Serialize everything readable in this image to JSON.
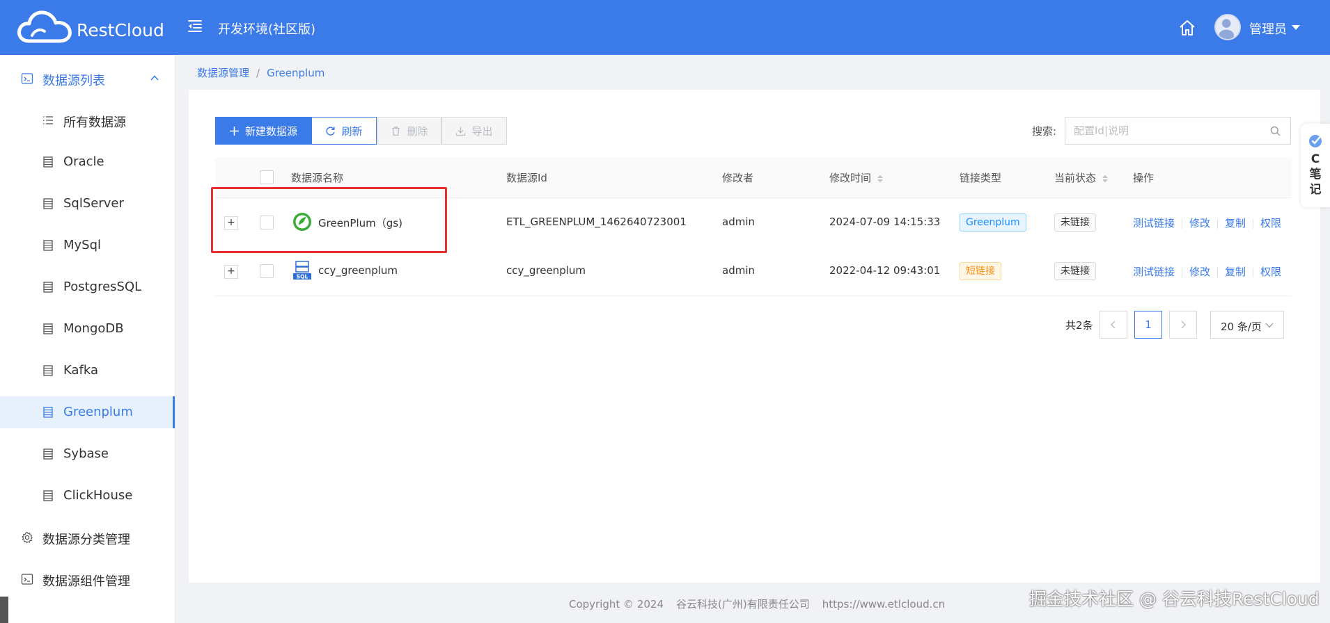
{
  "header": {
    "app_name": "RestCloud",
    "env_title": "开发环境(社区版)",
    "user_name": "管理员"
  },
  "sidebar": {
    "items": [
      {
        "label": "数据源列表",
        "type": "parent",
        "icon": "terminal-icon",
        "open": true
      },
      {
        "label": "所有数据源",
        "type": "child",
        "icon": "list-icon"
      },
      {
        "label": "Oracle",
        "type": "child",
        "icon": "database-icon"
      },
      {
        "label": "SqlServer",
        "type": "child",
        "icon": "database-icon"
      },
      {
        "label": "MySql",
        "type": "child",
        "icon": "database-icon"
      },
      {
        "label": "PostgresSQL",
        "type": "child",
        "icon": "database-icon"
      },
      {
        "label": "MongoDB",
        "type": "child",
        "icon": "database-icon"
      },
      {
        "label": "Kafka",
        "type": "child",
        "icon": "database-icon"
      },
      {
        "label": "Greenplum",
        "type": "child",
        "icon": "database-icon",
        "active": true
      },
      {
        "label": "Sybase",
        "type": "child",
        "icon": "database-icon"
      },
      {
        "label": "ClickHouse",
        "type": "child",
        "icon": "database-icon"
      },
      {
        "label": "数据源分类管理",
        "type": "parent",
        "icon": "gear-icon"
      },
      {
        "label": "数据源组件管理",
        "type": "parent",
        "icon": "terminal-icon"
      }
    ]
  },
  "breadcrumb": {
    "root": "数据源管理",
    "separator": "/",
    "current": "Greenplum"
  },
  "toolbar": {
    "new_label": "新建数据源",
    "refresh_label": "刷新",
    "delete_label": "删除",
    "export_label": "导出",
    "search_label": "搜索:",
    "search_placeholder": "配置Id|说明",
    "search_value": ""
  },
  "table": {
    "headers": {
      "name": "数据源名称",
      "id": "数据源Id",
      "modifier": "修改者",
      "time": "修改时间",
      "link_type": "链接类型",
      "status": "当前状态",
      "actions": "操作"
    },
    "rows": [
      {
        "name": "GreenPlum（gs)",
        "icon": "greenplum-logo-icon",
        "id": "ETL_GREENPLUM_1462640723001",
        "modifier": "admin",
        "time": "2024-07-09 14:15:33",
        "link_type": "Greenplum",
        "link_color": "blue",
        "status": "未链接"
      },
      {
        "name": "ccy_greenplum",
        "icon": "sql-server-icon",
        "id": "ccy_greenplum",
        "modifier": "admin",
        "time": "2022-04-12 09:43:01",
        "link_type": "短链接",
        "link_color": "orange",
        "status": "未链接"
      }
    ],
    "row_actions": [
      "测试链接",
      "修改",
      "复制",
      "权限"
    ],
    "expand_symbol": "+"
  },
  "pagination": {
    "total": "共2条",
    "current_page": "1",
    "page_size": "20 条/页"
  },
  "footer": {
    "copyright": "Copyright © 2024",
    "company": "谷云科技(广州)有限责任公司",
    "url": "https://www.etlcloud.cn"
  },
  "watermark": "掘金技术社区 @ 谷云科技RestCloud",
  "float_panel": {
    "text": "C笔记"
  },
  "colors": {
    "primary": "#3a7be9",
    "highlight_border": "#e4312b",
    "tag_blue": "#1890ff",
    "tag_orange": "#fa8c16"
  }
}
